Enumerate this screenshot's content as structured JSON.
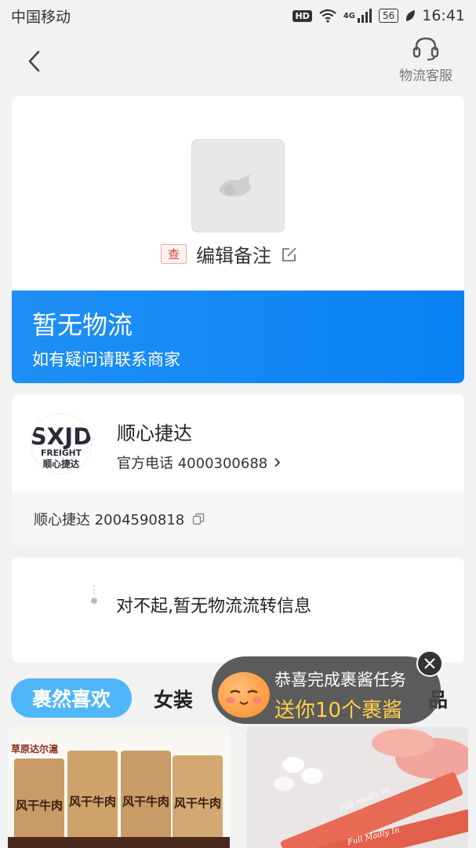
{
  "status_bar": {
    "carrier": "中国移动",
    "hd": "HD",
    "network": "4G",
    "battery": "56",
    "time": "16:41"
  },
  "nav": {
    "service_label": "物流客服"
  },
  "order": {
    "tag": "查",
    "note_label": "编辑备注"
  },
  "banner": {
    "title": "暂无物流",
    "subtitle": "如有疑问请联系商家"
  },
  "courier": {
    "name": "顺心捷达",
    "phone_label": "官方电话 4000300688",
    "tracking": "顺心捷达 2004590818",
    "logo_text": "SXJD",
    "logo_sub": "FREIGHT",
    "logo_cn": "顺心捷达"
  },
  "info": {
    "message": "对不起,暂无物流流转信息"
  },
  "tabs": [
    {
      "label": "裹然喜欢"
    },
    {
      "label": "女装"
    },
    {
      "label": "品"
    }
  ],
  "toast": {
    "line1": "恭喜完成裹酱任务",
    "line2": "送你10个裹酱"
  },
  "products": [
    {
      "brand": "草原达尔滬",
      "item": "风干牛肉"
    },
    {
      "item": "Full Madly In"
    }
  ]
}
